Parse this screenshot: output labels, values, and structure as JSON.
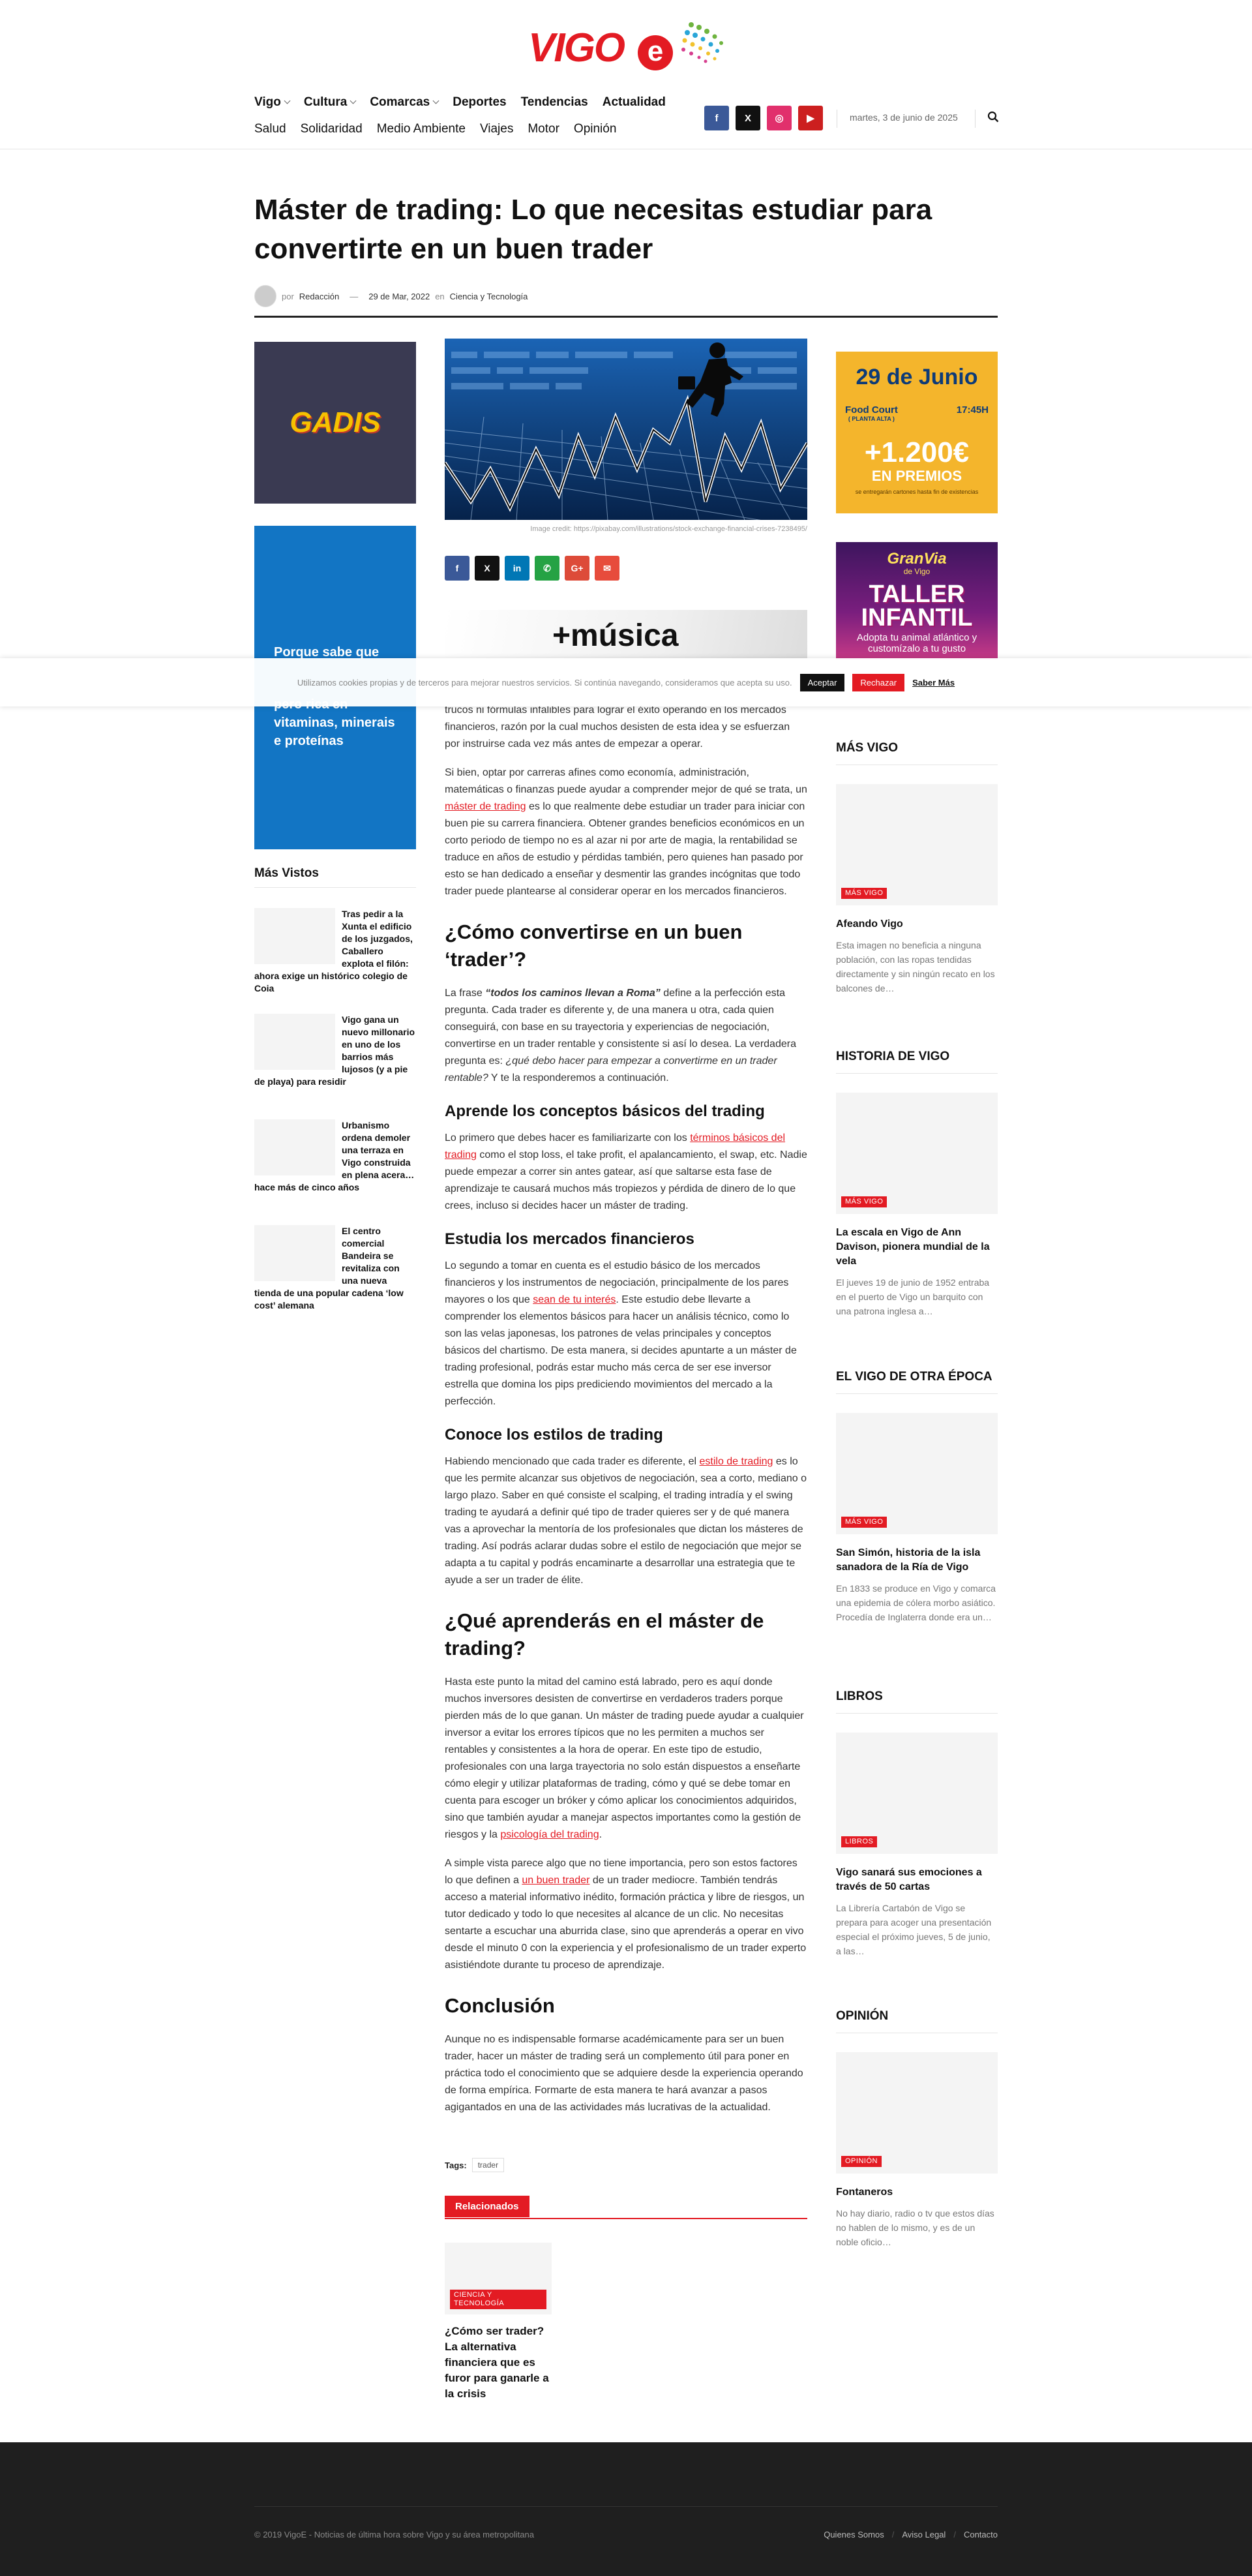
{
  "site": {
    "logo_text": "VIGO",
    "logo_e": "e"
  },
  "nav": {
    "primary": [
      {
        "label": "Vigo",
        "dropdown": true
      },
      {
        "label": "Cultura",
        "dropdown": true
      },
      {
        "label": "Comarcas",
        "dropdown": true
      },
      {
        "label": "Deportes",
        "dropdown": false
      },
      {
        "label": "Tendencias",
        "dropdown": false
      },
      {
        "label": "Actualidad",
        "dropdown": false
      }
    ],
    "secondary": [
      "Salud",
      "Solidaridad",
      "Medio Ambiente",
      "Viajes",
      "Motor",
      "Opinión"
    ]
  },
  "header": {
    "socials": [
      {
        "name": "facebook-icon",
        "glyph": "f",
        "color": "#3b5998"
      },
      {
        "name": "x-icon",
        "glyph": "X",
        "color": "#111111"
      },
      {
        "name": "instagram-icon",
        "glyph": "◎",
        "color": "#e1306c"
      },
      {
        "name": "youtube-icon",
        "glyph": "▶",
        "color": "#cc1f1f"
      }
    ],
    "date": "martes, 3 de junio de 2025"
  },
  "article": {
    "title": "Máster de trading: Lo que necesitas estudiar para convertirte en un buen trader",
    "by": "por",
    "author": "Redacción",
    "dash": "—",
    "date": "29 de Mar, 2022",
    "in": "en",
    "category": "Ciencia y Tecnología",
    "image_credit": "Image credit: https://pixabay.com/illustrations/stock-exchange-financial-crises-7238495/",
    "share": [
      {
        "name": "share-facebook-button",
        "glyph": "f",
        "color": "#3b5998"
      },
      {
        "name": "share-x-button",
        "glyph": "X",
        "color": "#111111"
      },
      {
        "name": "share-linkedin-button",
        "glyph": "in",
        "color": "#0077b5"
      },
      {
        "name": "share-whatsapp-button",
        "glyph": "✆",
        "color": "#25a244"
      },
      {
        "name": "share-google-button",
        "glyph": "G+",
        "color": "#dd4b39"
      },
      {
        "name": "share-email-button",
        "glyph": "✉",
        "color": "#e74c3c"
      }
    ],
    "ad_musica": "+música",
    "p1": "trucos ni fórmulas infalibles para lograr el éxito operando en los mercados financieros, razón por la cual muchos desisten de esta idea y se esfuerzan por instruirse cada vez más antes de empezar a operar.",
    "p2_a": "Si bien, optar por carreras afines como economía, administración, matemáticas o finanzas puede ayudar a comprender mejor de qué se trata, un ",
    "p2_link": "máster de trading",
    "p2_b": " es lo que realmente debe estudiar un trader para iniciar con buen pie su carrera financiera. Obtener grandes beneficios económicos en un corto periodo de tiempo no es al azar ni por arte de magia, la rentabilidad se traduce en años de estudio y pérdidas también, pero quienes han pasado por esto se han dedicado a enseñar y desmentir las grandes incógnitas que todo trader puede plantearse al considerar operar en los mercados financieros.",
    "h2_1": "¿Cómo convertirse en un buen ‘trader’?",
    "p3_a": "La frase ",
    "p3_quote": "“todos los caminos llevan a Roma”",
    "p3_b": " define a la perfección esta pregunta. Cada trader es diferente y, de una manera u otra, cada quien conseguirá, con base en su trayectoria y experiencias de negociación, convertirse en un trader rentable y consistente si así lo desea. La verdadera pregunta es: ",
    "p3_italic": "¿qué debo hacer para empezar a convertirme en un trader rentable?",
    "p3_c": " Y te la responderemos a continuación.",
    "h3_1": "Aprende los conceptos básicos del trading",
    "p4_a": "Lo primero que debes hacer es familiarizarte con los ",
    "p4_link": "términos básicos del trading",
    "p4_b": " como el stop loss, el take profit, el apalancamiento, el swap, etc. Nadie puede empezar a correr sin antes gatear, así que saltarse esta fase de aprendizaje te causará muchos más tropiezos y pérdida de dinero de lo que crees, incluso si decides hacer un máster de trading.",
    "h3_2": "Estudia los mercados financieros",
    "p5_a": "Lo segundo a tomar en cuenta es el estudio básico de los mercados financieros y los instrumentos de negociación, principalmente de los pares mayores o los que ",
    "p5_link": "sean de tu interés",
    "p5_b": ". Este estudio debe llevarte a comprender los elementos básicos para hacer un análisis técnico, como lo son las velas japonesas, los patrones de velas principales y conceptos básicos del chartismo. De esta manera, si decides apuntarte a un máster de trading profesional, podrás estar mucho más cerca de ser ese inversor estrella que domina los pips prediciendo movimientos del mercado a la perfección.",
    "h3_3": "Conoce los estilos de trading",
    "p6_a": "Habiendo mencionado que cada trader es diferente, el ",
    "p6_link": "estilo de trading",
    "p6_b": " es lo que les permite alcanzar sus objetivos de negociación, sea a corto, mediano o largo plazo. Saber en qué consiste el scalping, el trading intradía y el swing trading te ayudará a definir qué tipo de trader quieres ser y de qué manera vas a aprovechar la mentoría de los profesionales que dictan los másteres de trading. Así podrás aclarar dudas sobre el estilo de negociación que mejor se adapta a tu capital y podrás encaminarte a desarrollar una estrategia que te ayude a ser un trader de élite.",
    "h2_2": "¿Qué aprenderás en el máster de trading?",
    "p7_a": "Hasta este punto la mitad del camino está labrado, pero es aquí donde muchos inversores desisten de convertirse en verdaderos traders porque pierden más de lo que ganan. Un máster de trading puede ayudar a cualquier inversor a evitar los errores típicos que no les permiten a muchos ser rentables y consistentes a la hora de operar. En este tipo de estudio, profesionales con una larga trayectoria no solo están dispuestos a enseñarte cómo elegir y utilizar plataformas de trading, cómo y qué se debe tomar en cuenta para escoger un bróker y cómo aplicar los conocimientos adquiridos, sino que también ayudar a manejar aspectos importantes como la gestión de riesgos y la ",
    "p7_link": "psicología del trading",
    "p7_b": ".",
    "p8_a": "A simple vista parece algo que no tiene importancia, pero son estos factores lo que definen a ",
    "p8_link": "un buen trader",
    "p8_b": " de un trader mediocre. También tendrás acceso a material informativo inédito, formación práctica y libre de riesgos, un tutor dedicado y todo lo que necesites al alcance de un clic. No necesitas sentarte a escuchar una aburrida clase, sino que aprenderás a operar en vivo desde el minuto 0 con la experiencia y el profesionalismo de un trader experto asistiéndote durante tu proceso de aprendizaje.",
    "h2_3": "Conclusión",
    "p9": "Aunque no es indispensable formarse académicamente para ser un buen trader, hacer un máster de trading será un complemento útil para poner en práctica todo el conocimiento que se adquiere desde la experiencia operando de forma empírica. Formarte de esta manera te hará avanzar a pasos agigantados en una de las actividades más lucrativas de la actualidad.",
    "tags_label": "Tags:",
    "tags": [
      "trader"
    ],
    "related_label": "Relacionados",
    "related": [
      {
        "badge": "Ciencia y Tecnología",
        "title": "¿Cómo ser trader? La alternativa financiera que es furor para ganarle a la crisis"
      }
    ]
  },
  "left_sidebar": {
    "gadis": "GADIS",
    "blue_ad_text": "Porque sabe que pero rica en vitaminas, minerais e proteínas",
    "blue_ad_line1": "Porque sabe que",
    "blue_ad_line2": "pero rica en vitaminas, minerais e proteínas",
    "mas_vistos_title": "Más Vistos",
    "mas_vistos": [
      "Tras pedir a la Xunta el edificio de los juzgados, Caballero explota el filón: ahora exige un histórico colegio de Coia",
      "Vigo gana un nuevo millonario en uno de los barrios más lujosos (y a pie de playa) para residir",
      "Urbanismo ordena demoler una terraza en Vigo construida en plena acera… hace más de cinco años",
      "El centro comercial Bandeira se revitaliza con una nueva tienda de una popular cadena ‘low cost’ alemana"
    ]
  },
  "right_sidebar": {
    "junio": {
      "date": "29 de Junio",
      "place": "Food Court",
      "place_sub": "( PLANTA ALTA )",
      "time": "17:45H",
      "amount": "+1.200€",
      "premios": "EN PREMIOS",
      "note": "se entregarán cartones hasta fin de existencias"
    },
    "gran": {
      "logo": "GranVia",
      "sub": "de Vigo",
      "title1": "TALLER",
      "title2": "INFANTIL",
      "adopt": "Adopta tu animal atlántico y customízalo a tu gusto"
    },
    "sections": [
      {
        "head": "MÁS VIGO",
        "badge": "Más Vigo",
        "title": "Afeando Vigo",
        "excerpt": "Esta imagen no beneficia a ninguna población, con las ropas tendidas directamente y sin ningún recato en los balcones de…"
      },
      {
        "head": "HISTORIA DE VIGO",
        "badge": "Más Vigo",
        "title": "La escala en Vigo de Ann Davison, pionera mundial de la vela",
        "excerpt": "El jueves 19 de junio de 1952 entraba en el puerto de Vigo un barquito con una patrona inglesa a…"
      },
      {
        "head": "EL VIGO DE OTRA ÉPOCA",
        "badge": "Más Vigo",
        "title": "San Simón, historia de la isla sanadora de la Ría de Vigo",
        "excerpt": "En 1833 se produce en Vigo y comarca una epidemia de cólera morbo asiático. Procedía de Inglaterra donde era un…"
      },
      {
        "head": "LIBROS",
        "badge": "Libros",
        "title": "Vigo sanará sus emociones a través de 50 cartas",
        "excerpt": "La Librería Cartabón de Vigo se prepara para acoger una presentación especial el próximo jueves, 5 de junio, a las…"
      },
      {
        "head": "OPINIÓN",
        "badge": "Opinión",
        "title": "Fontaneros",
        "excerpt": "No hay diario, radio o tv que estos días no hablen de lo mismo, y es de un noble oficio…"
      }
    ]
  },
  "cookie": {
    "text": "Utilizamos cookies propias y de terceros para mejorar nuestros servicios. Si continúa navegando, consideramos que acepta su uso.",
    "accept": "Aceptar",
    "reject": "Rechazar",
    "more": "Saber Más"
  },
  "footer": {
    "copyright": "© 2019 VigoE - Noticias de última hora sobre Vigo y su área metropolitana",
    "links": [
      "Quienes Somos",
      "Aviso Legal",
      "Contacto"
    ]
  }
}
